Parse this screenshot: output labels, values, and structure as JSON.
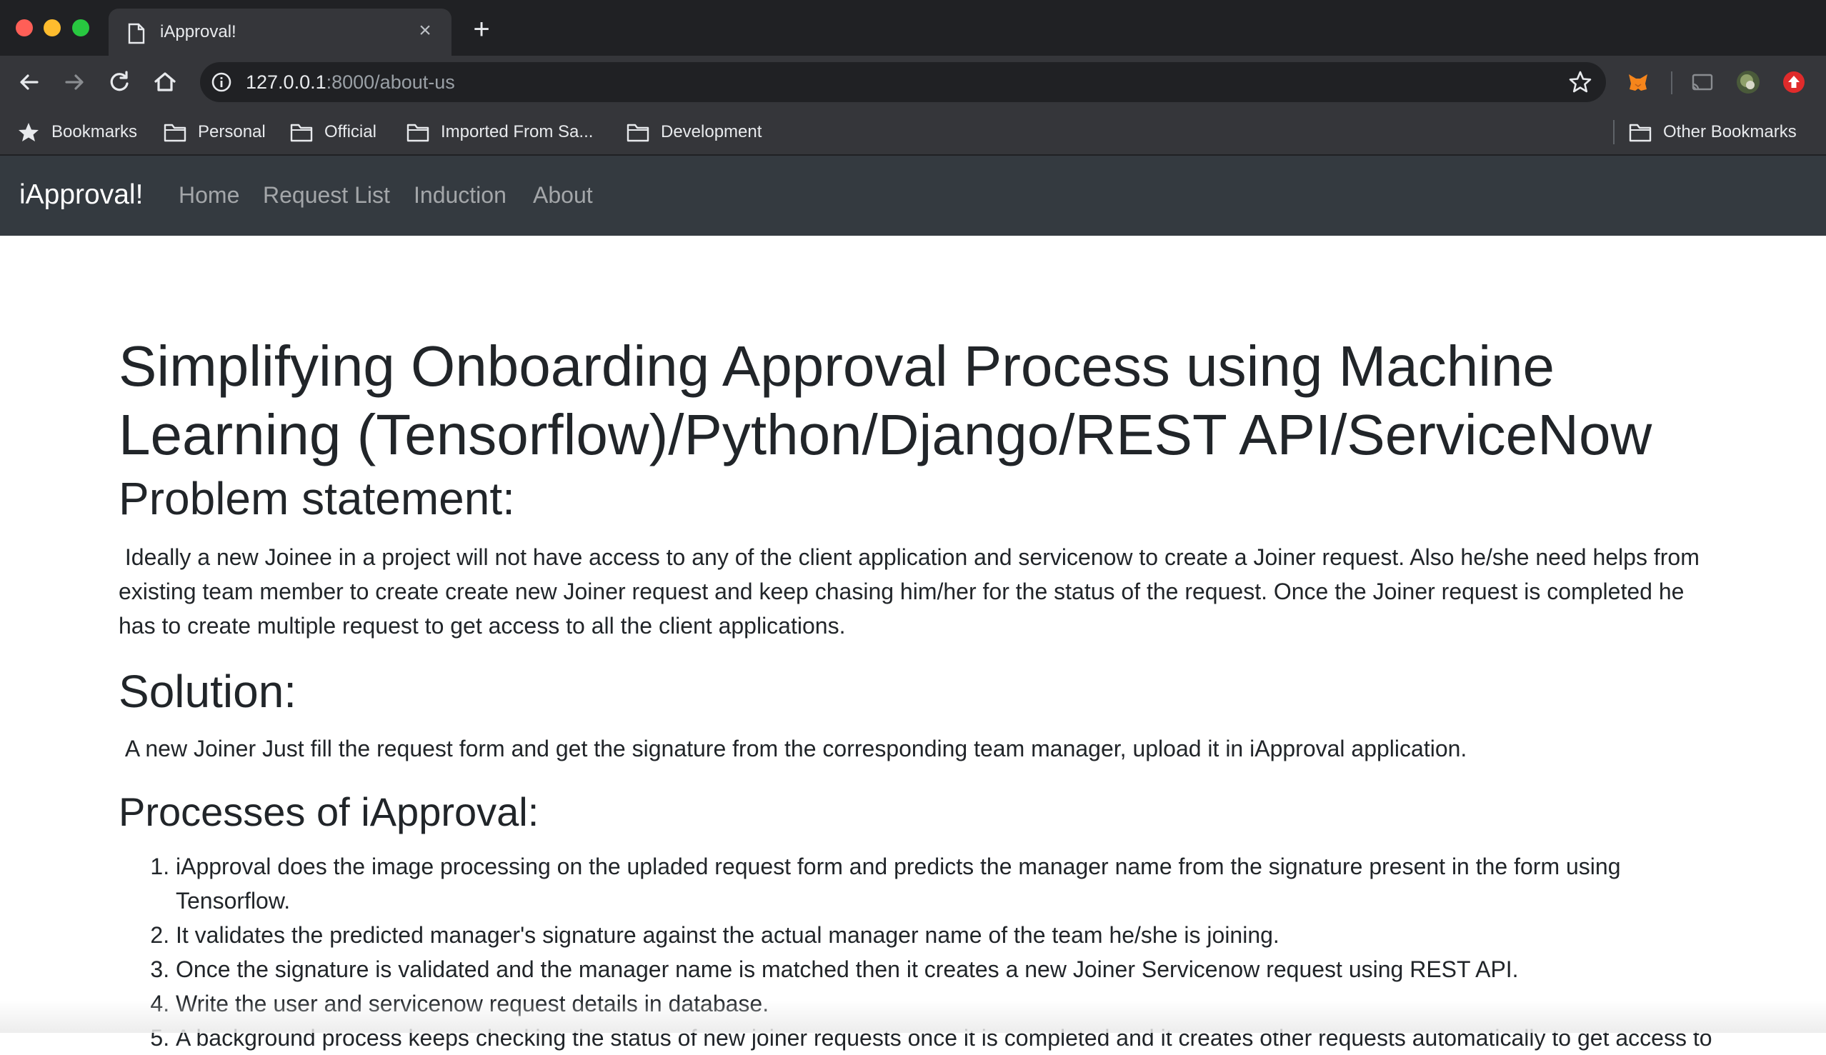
{
  "browser": {
    "tab_title": "iApproval!",
    "url_host": "127.0.0.1",
    "url_path": ":8000/about-us",
    "bookmarks": [
      {
        "label": "Bookmarks"
      },
      {
        "label": "Personal"
      },
      {
        "label": "Official"
      },
      {
        "label": "Imported From Sa..."
      },
      {
        "label": "Development"
      }
    ],
    "other_bookmarks": "Other Bookmarks"
  },
  "navbar": {
    "brand": "iApproval!",
    "links": [
      "Home",
      "Request List",
      "Induction",
      "About"
    ]
  },
  "content": {
    "title": "Simplifying Onboarding Approval Process using Machine Learning (Tensorflow)/Python/Django/REST API/ServiceNow",
    "problem_heading": "Problem statement:",
    "problem_text": "Ideally a new Joinee in a project will not have access to any of the client application and servicenow to create a Joiner request. Also he/she need helps from existing team member to create create new Joiner request and keep chasing him/her for the status of the request. Once the Joiner request is completed he has to create multiple request to get access to all the client applications.",
    "solution_heading": "Solution:",
    "solution_text": "A new Joiner Just fill the request form and get the signature from the corresponding team manager, upload it in iApproval application.",
    "processes_heading": "Processes of iApproval:",
    "steps": [
      "iApproval does the image processing on the upladed request form and predicts the manager name from the signature present in the form using Tensorflow.",
      "It validates the predicted manager's signature against the actual manager name of the team he/she is joining.",
      "Once the signature is validated and the manager name is matched then it creates a new Joiner Servicenow request using REST API.",
      "Write the user and servicenow request details in database.",
      "A background process keeps checking the status of new joiner requests once it is completed and it creates other requests automatically to get access to"
    ]
  }
}
